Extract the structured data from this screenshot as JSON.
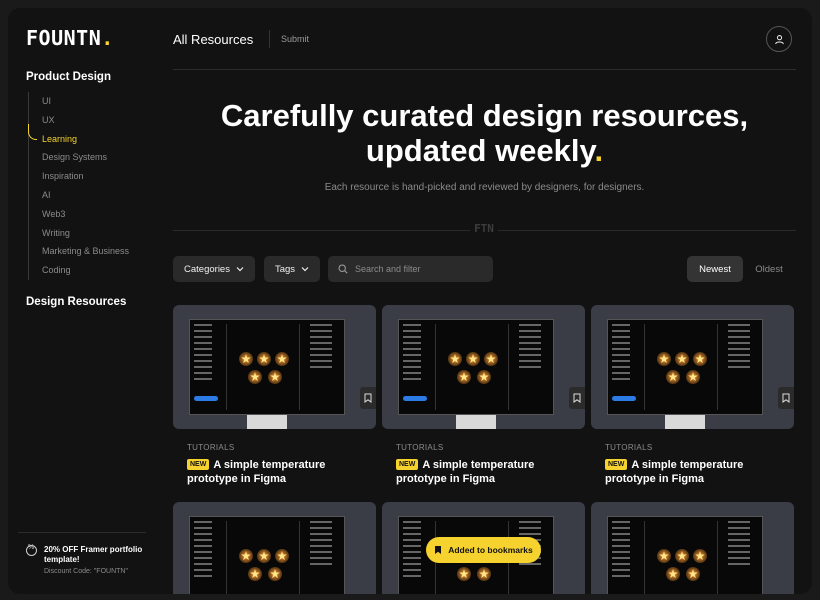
{
  "brand": {
    "logo_text": "FOUNTN",
    "logo_dot": ".",
    "accent": "#f5d22e"
  },
  "sidebar": {
    "product_design_title": "Product Design",
    "items": [
      {
        "label": "UI",
        "active": false
      },
      {
        "label": "UX",
        "active": false
      },
      {
        "label": "Learning",
        "active": true
      },
      {
        "label": "Design Systems",
        "active": false
      },
      {
        "label": "Inspiration",
        "active": false
      },
      {
        "label": "AI",
        "active": false
      },
      {
        "label": "Web3",
        "active": false
      },
      {
        "label": "Writing",
        "active": false
      },
      {
        "label": "Marketing & Business",
        "active": false
      },
      {
        "label": "Coding",
        "active": false
      }
    ],
    "design_resources_title": "Design Resources",
    "promo": {
      "icon": "discount-icon",
      "title": "20% OFF Framer portfolio template!",
      "code": "Discount Code: \"FOUNTN\""
    }
  },
  "header": {
    "title": "All Resources",
    "submit_label": "Submit",
    "user_icon": "user-icon"
  },
  "hero": {
    "title_line1": "Carefully curated design resources,",
    "title_line2": "updated weekly",
    "title_dot": ".",
    "subtitle": "Each resource is hand-picked and reviewed by designers, for designers.",
    "divider_mark": "FTN"
  },
  "filters": {
    "categories_label": "Categories",
    "tags_label": "Tags",
    "search_placeholder": "Search and filter",
    "sort_newest": "Newest",
    "sort_oldest": "Oldest",
    "sort_selected": "Newest"
  },
  "cards": [
    {
      "category": "TUTORIALS",
      "badge": "NEW",
      "title": "A simple temperature prototype in Figma"
    },
    {
      "category": "TUTORIALS",
      "badge": "NEW",
      "title": "A simple temperature prototype in Figma"
    },
    {
      "category": "TUTORIALS",
      "badge": "NEW",
      "title": "A simple temperature prototype in Figma"
    }
  ],
  "toast": {
    "label": "Added to bookmarks",
    "icon": "bookmark-icon"
  }
}
